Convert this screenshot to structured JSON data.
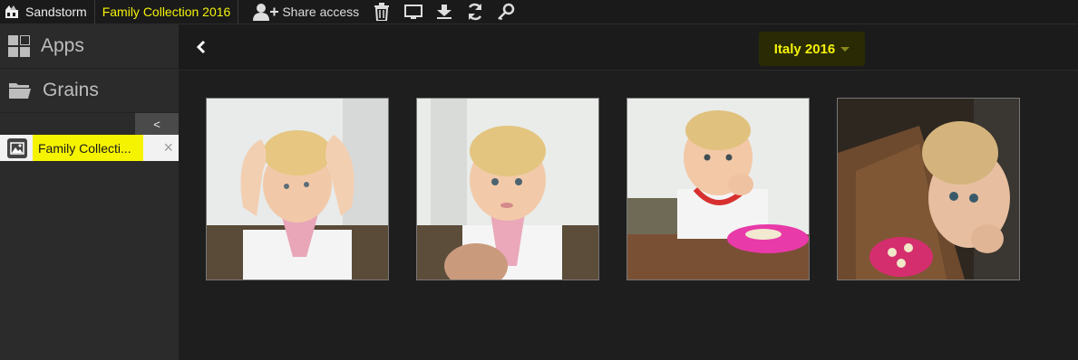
{
  "topbar": {
    "brand": "Sandstorm",
    "grain_title": "Family Collection 2016",
    "share_label": "Share access",
    "icons": [
      "user-plus-icon",
      "trash-icon",
      "monitor-icon",
      "download-icon",
      "refresh-icon",
      "key-icon"
    ]
  },
  "sidebar": {
    "items": [
      {
        "label": "Apps",
        "icon": "grid-icon"
      },
      {
        "label": "Grains",
        "icon": "folder-icon"
      }
    ],
    "collapse_label": "<",
    "open_grain": {
      "label": "Family Collecti...",
      "close": "×"
    }
  },
  "main": {
    "album_label": "Italy 2016",
    "photos": [
      {
        "alt": "Toddler with hands on head, pink bib"
      },
      {
        "alt": "Toddler looking at camera, pink bib"
      },
      {
        "alt": "Toddler eating with pink plate"
      },
      {
        "alt": "Toddler peeking close to camera"
      }
    ]
  },
  "colors": {
    "accent": "#f4f20a",
    "sidebar": "#2b2b2b",
    "background": "#1e1e1e"
  }
}
